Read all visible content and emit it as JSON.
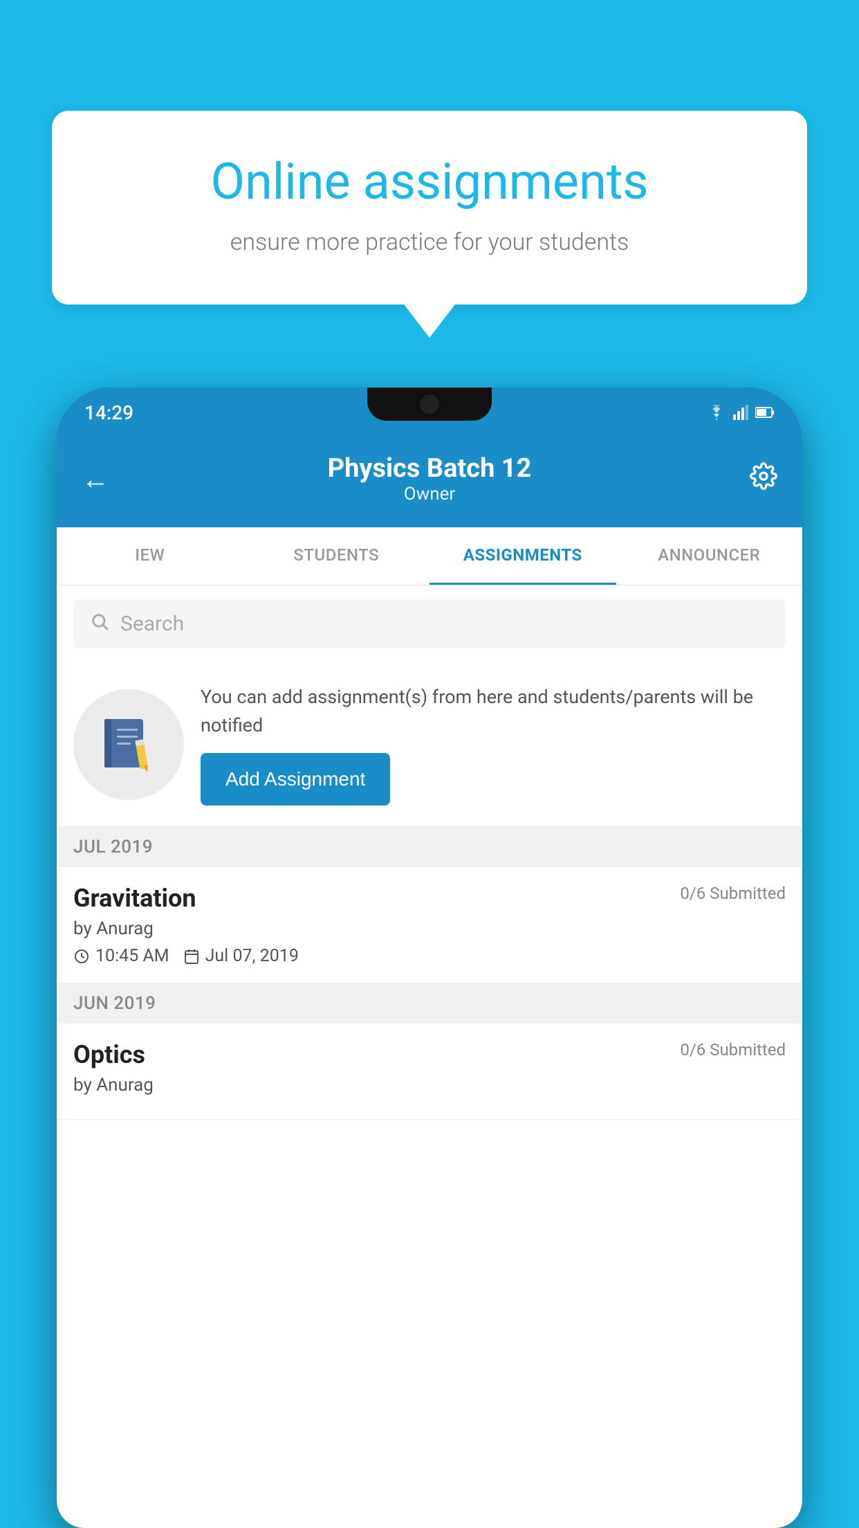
{
  "background_color": "#1BB8E8",
  "speech_bubble": {
    "title": "Online assignments",
    "subtitle": "ensure more practice for your students"
  },
  "status_bar": {
    "time": "14:29"
  },
  "top_bar": {
    "title": "Physics Batch 12",
    "subtitle": "Owner",
    "back_label": "←",
    "settings_label": "⚙"
  },
  "tabs": [
    {
      "label": "IEW",
      "active": false
    },
    {
      "label": "STUDENTS",
      "active": false
    },
    {
      "label": "ASSIGNMENTS",
      "active": true
    },
    {
      "label": "ANNOUNCER",
      "active": false
    }
  ],
  "search": {
    "placeholder": "Search"
  },
  "promo": {
    "description": "You can add assignment(s) from here and students/parents will be notified",
    "button_label": "Add Assignment"
  },
  "sections": [
    {
      "header": "JUL 2019",
      "assignments": [
        {
          "name": "Gravitation",
          "submitted": "0/6 Submitted",
          "by": "by Anurag",
          "time": "10:45 AM",
          "date": "Jul 07, 2019"
        }
      ]
    },
    {
      "header": "JUN 2019",
      "assignments": [
        {
          "name": "Optics",
          "submitted": "0/6 Submitted",
          "by": "by Anurag",
          "time": "",
          "date": ""
        }
      ]
    }
  ]
}
